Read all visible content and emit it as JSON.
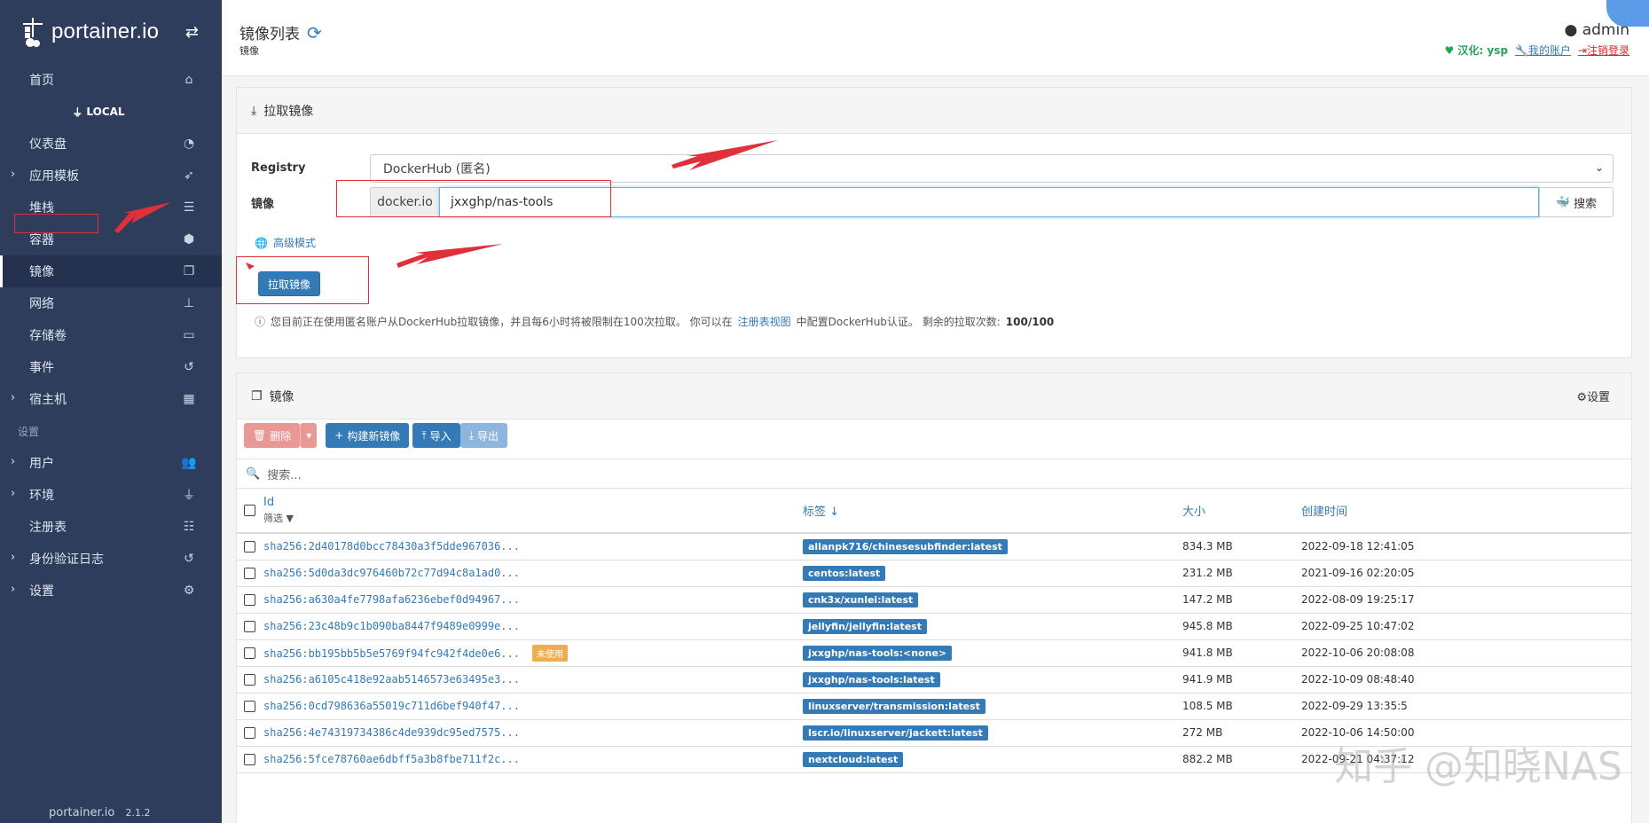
{
  "brand": {
    "name": "portainer.io",
    "footer": "portainer.io",
    "version": "2.1.2"
  },
  "sidebar": {
    "items": [
      {
        "label": "首页",
        "icon": "home-icon",
        "type": "item"
      },
      {
        "label": "LOCAL",
        "icon": "plug-icon",
        "type": "section"
      },
      {
        "label": "仪表盘",
        "icon": "tachometer-icon",
        "type": "item"
      },
      {
        "label": "应用模板",
        "icon": "rocket-icon",
        "type": "expand"
      },
      {
        "label": "堆栈",
        "icon": "list-icon",
        "type": "item"
      },
      {
        "label": "容器",
        "icon": "cubes-icon",
        "type": "item"
      },
      {
        "label": "镜像",
        "icon": "clone-icon",
        "type": "item",
        "active": true
      },
      {
        "label": "网络",
        "icon": "sitemap-icon",
        "type": "item"
      },
      {
        "label": "存储卷",
        "icon": "hdd-icon",
        "type": "item"
      },
      {
        "label": "事件",
        "icon": "history-icon",
        "type": "item"
      },
      {
        "label": "宿主机",
        "icon": "th-icon",
        "type": "expand"
      },
      {
        "label": "设置",
        "icon": "",
        "type": "group"
      },
      {
        "label": "用户",
        "icon": "users-icon",
        "type": "expand"
      },
      {
        "label": "环境",
        "icon": "plug-icon",
        "type": "expand"
      },
      {
        "label": "注册表",
        "icon": "database-icon",
        "type": "item"
      },
      {
        "label": "身份验证日志",
        "icon": "history-icon",
        "type": "expand"
      },
      {
        "label": "设置",
        "icon": "cogs-icon",
        "type": "expand"
      }
    ]
  },
  "header": {
    "title": "镜像列表",
    "breadcrumb": "镜像",
    "user": "admin",
    "credit": "汉化: ysp",
    "account_link": "我的账户",
    "logout_link": "注销登录"
  },
  "pull": {
    "title": "拉取镜像",
    "registry_label": "Registry",
    "registry_value": "DockerHub (匿名)",
    "image_label": "镜像",
    "prefix": "docker.io",
    "image_value": "jxxghp/nas-tools",
    "search_label": "搜索",
    "advanced_label": "高级模式",
    "button_label": "拉取镜像",
    "info_prefix": "您目前正在使用匿名账户从DockerHub拉取镜像，并且每6小时将被限制在100次拉取。 你可以在",
    "info_link": "注册表视图",
    "info_suffix": "中配置DockerHub认证。 剩余的拉取次数:",
    "remaining": "100/100"
  },
  "images": {
    "title": "镜像",
    "settings_label": "设置",
    "toolbar": {
      "delete": "删除",
      "build": "构建新镜像",
      "import": "导入",
      "export": "导出"
    },
    "search_placeholder": "搜索...",
    "columns": {
      "id": "Id",
      "filter": "筛选",
      "tags": "标签",
      "size": "大小",
      "created": "创建时间"
    },
    "rows": [
      {
        "id": "sha256:2d40178d0bcc78430a3f5dde967036...",
        "tag": "allanpk716/chinesesubfinder:latest",
        "size": "834.3 MB",
        "created": "2022-09-18 12:41:05"
      },
      {
        "id": "sha256:5d0da3dc976460b72c77d94c8a1ad0...",
        "tag": "centos:latest",
        "size": "231.2 MB",
        "created": "2021-09-16 02:20:05"
      },
      {
        "id": "sha256:a630a4fe7798afa6236ebef0d94967...",
        "tag": "cnk3x/xunlei:latest",
        "size": "147.2 MB",
        "created": "2022-08-09 19:25:17"
      },
      {
        "id": "sha256:23c48b9c1b090ba8447f9489e0999e...",
        "tag": "jellyfin/jellyfin:latest",
        "size": "945.8 MB",
        "created": "2022-09-25 10:47:02"
      },
      {
        "id": "sha256:bb195bb5b5e5769f94fc942f4de0e6...",
        "unused": "未使用",
        "tag": "jxxghp/nas-tools:<none>",
        "size": "941.8 MB",
        "created": "2022-10-06 20:08:08"
      },
      {
        "id": "sha256:a6105c418e92aab5146573e63495e3...",
        "tag": "jxxghp/nas-tools:latest",
        "size": "941.9 MB",
        "created": "2022-10-09 08:48:40"
      },
      {
        "id": "sha256:0cd798636a55019c711d6bef940f47...",
        "tag": "linuxserver/transmission:latest",
        "size": "108.5 MB",
        "created": "2022-09-29 13:35:5"
      },
      {
        "id": "sha256:4e74319734386c4de939dc95ed7575...",
        "tag": "lscr.io/linuxserver/jackett:latest",
        "size": "272 MB",
        "created": "2022-10-06 14:50:00"
      },
      {
        "id": "sha256:5fce78760ae6dbff5a3b8fbe711f2c...",
        "tag": "nextcloud:latest",
        "size": "882.2 MB",
        "created": "2022-09-21 04:37:12"
      }
    ]
  },
  "watermark": "知乎 @知晓NAS",
  "colors": {
    "sidebar": "#2e3d5c",
    "primary": "#337ab7",
    "annotation": "#e0303a",
    "unused": "#f0ad4e"
  }
}
